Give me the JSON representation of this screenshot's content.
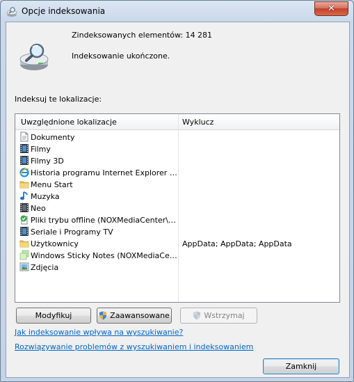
{
  "window": {
    "title": "Opcje indeksowania"
  },
  "status": {
    "indexed_count_label": "Zindeksowanych elementów: 14 281",
    "state": "Indeksowanie ukończone."
  },
  "locations_label": "Indeksuj te lokalizacje:",
  "table": {
    "headers": [
      "Uwzględnione lokalizacje",
      "Wyklucz"
    ],
    "rows": [
      {
        "name": "Dokumenty",
        "exclude": "",
        "icon": "document-icon"
      },
      {
        "name": "Filmy",
        "exclude": "",
        "icon": "film-icon"
      },
      {
        "name": "Filmy 3D",
        "exclude": "",
        "icon": "film-icon"
      },
      {
        "name": "Historia programu Internet Explorer (NOX...",
        "exclude": "",
        "icon": "internet-explorer-icon"
      },
      {
        "name": "Menu Start",
        "exclude": "",
        "icon": "folder-icon"
      },
      {
        "name": "Muzyka",
        "exclude": "",
        "icon": "music-note-icon"
      },
      {
        "name": "Neo",
        "exclude": "",
        "icon": "film-icon"
      },
      {
        "name": "Pliki trybu offline (NOXMediaCenter\\NOX...",
        "exclude": "",
        "icon": "offline-files-icon"
      },
      {
        "name": "Seriale i Programy TV",
        "exclude": "",
        "icon": "film-icon"
      },
      {
        "name": "Użytkownicy",
        "exclude": "AppData; AppData; AppData",
        "icon": "folder-icon"
      },
      {
        "name": "Windows Sticky Notes (NOXMediaCenter...",
        "exclude": "",
        "icon": "sticky-notes-icon"
      },
      {
        "name": "Zdjęcia",
        "exclude": "",
        "icon": "picture-icon"
      }
    ]
  },
  "buttons": {
    "modify": "Modyfikuj",
    "advanced": "Zaawansowane",
    "pause": "Wstrzymaj",
    "close": "Zamknij"
  },
  "links": {
    "how_affects": "Jak indeksowanie wpływa na wyszukiwanie?",
    "troubleshoot": "Rozwiązywanie problemów z wyszukiwaniem i indeksowaniem"
  },
  "colors": {
    "link": "#0066cc",
    "close_button": "#c2402a"
  }
}
